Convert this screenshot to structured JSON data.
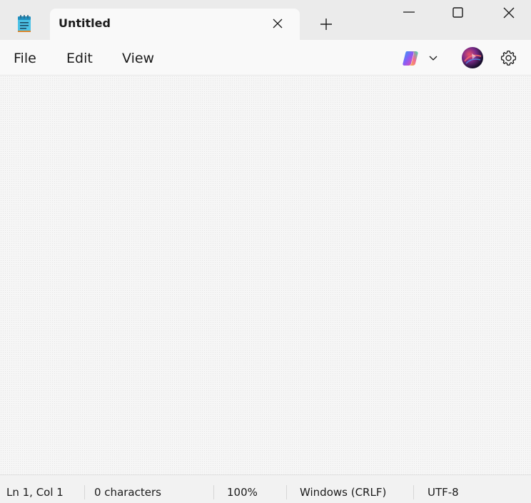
{
  "titlebar": {
    "app_icon": "notepad-icon",
    "tab_title": "Untitled",
    "tab_close_icon": "close-icon",
    "new_tab_icon": "plus-icon",
    "minimize_icon": "minimize-icon",
    "maximize_icon": "maximize-icon",
    "close_icon": "close-icon"
  },
  "menubar": {
    "file_label": "File",
    "edit_label": "Edit",
    "view_label": "View",
    "copilot_icon": "copilot-icon",
    "copilot_dropdown_icon": "chevron-down-icon",
    "avatar": "account-avatar",
    "settings_icon": "gear-icon"
  },
  "editor": {
    "content": ""
  },
  "statusbar": {
    "position": "Ln 1, Col 1",
    "characters": "0 characters",
    "zoom": "100%",
    "line_ending": "Windows (CRLF)",
    "encoding": "UTF-8"
  }
}
